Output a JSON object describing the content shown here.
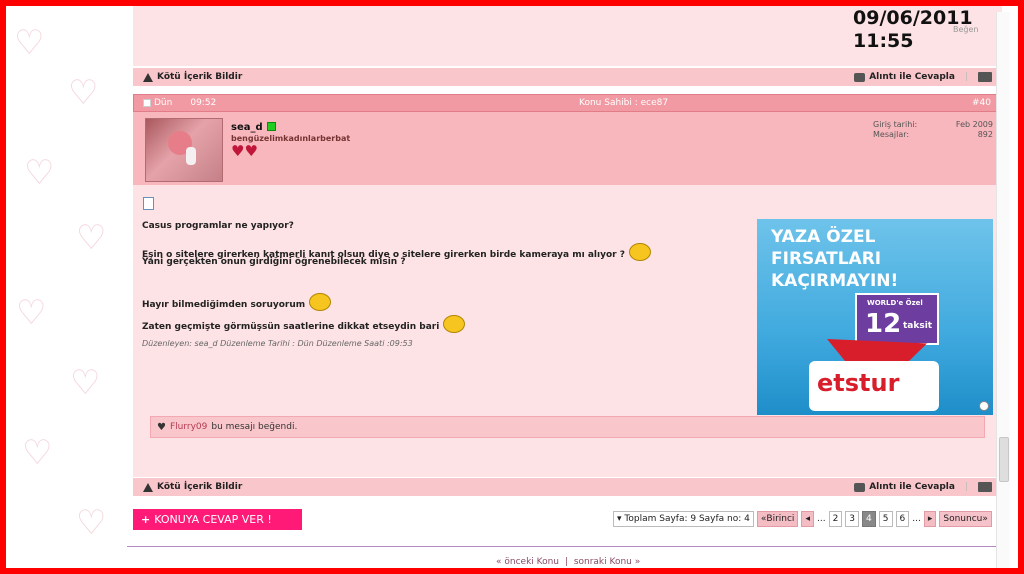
{
  "top_post": {
    "datetime_line1": "09/06/2011",
    "datetime_line2": "11:55",
    "like_label": "Beğen"
  },
  "action_bar": {
    "report_label": "Kötü İçerik Bildir",
    "quote_reply_label": "Alıntı ile Cevapla"
  },
  "post": {
    "date": "Dün",
    "time": "09:52",
    "owner_label": "Konu Sahibi : ece87",
    "number": "#40",
    "username": "sea_d",
    "user_title": "bengüzelimkadınlarberbat",
    "join_label": "Giriş tarihi:",
    "join_value": "Feb 2009",
    "messages_label": "Mesajlar:",
    "messages_value": "892",
    "lines": [
      "Casus programlar ne yapıyor?",
      "Eşin o sitelere girerken katmerli kanıt olsun diye o sitelere girerken birde kameraya mı alıyor ?",
      "Yani gerçekten onun girdiğini öğrenebilecek misin ?",
      "Hayır bilmediğimden soruyorum",
      "Zaten geçmişte görmüşsün saatlerine dikkat etseydin bari"
    ],
    "edited": "Düzenleyen: sea_d Düzenleme Tarihi : Dün Düzenleme Saati :09:53"
  },
  "ad": {
    "line1": "YAZA ÖZEL",
    "line2": "FIRSATLARI",
    "line3": "KAÇIRMAYIN!",
    "world": "WORLD'e Özel",
    "number": "12",
    "taksit": "taksit",
    "logo": "etstur"
  },
  "likes": {
    "user": "Flurry09",
    "text": "bu mesajı beğendi."
  },
  "reply_button": {
    "plus": "+",
    "label": "KONUYA CEVAP VER !"
  },
  "pager": {
    "summary": "Toplam Sayfa: 9 Sayfa no: 4",
    "first": "Birinci",
    "prev": "◂",
    "ellipsis": "...",
    "pages": [
      "2",
      "3",
      "4",
      "5",
      "6"
    ],
    "next": "▸",
    "last": "Sonuncu"
  },
  "footer": {
    "prev_topic": "« önceki Konu",
    "separator": "|",
    "next_topic": "sonraki Konu »"
  },
  "colors": {
    "frame": "#ff0000",
    "post_bg": "#fde3e5",
    "header_bg": "#f29aa3",
    "button": "#ff1a78"
  }
}
